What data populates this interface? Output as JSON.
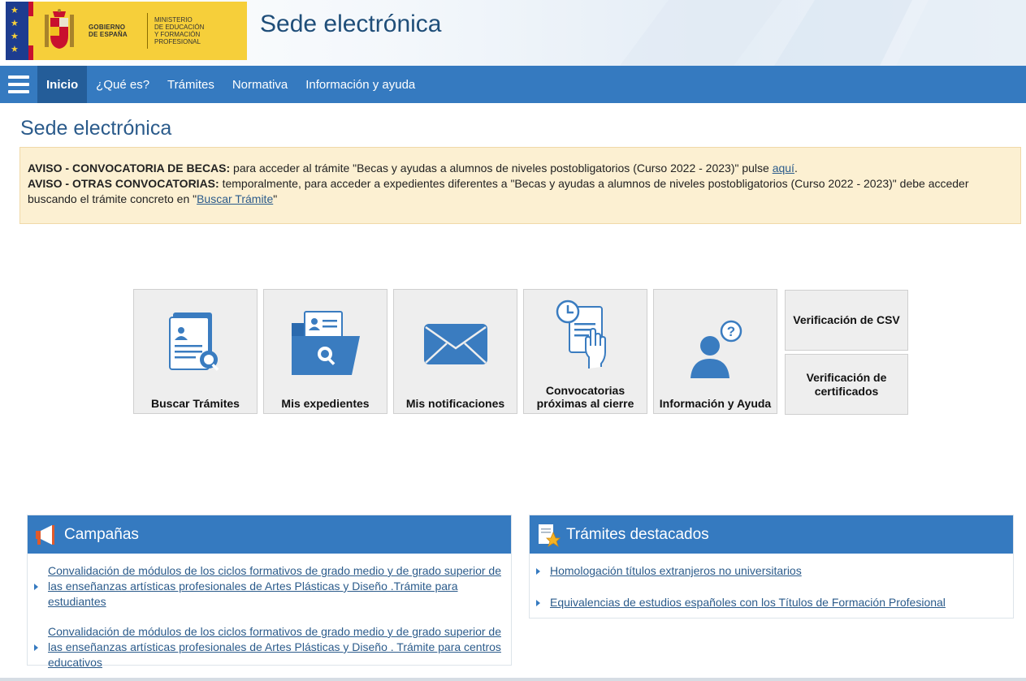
{
  "header": {
    "logo_line1": "GOBIERNO",
    "logo_line2": "DE ESPAÑA",
    "ministry_line1": "MINISTERIO",
    "ministry_line2": "DE EDUCACIÓN",
    "ministry_line3": "Y FORMACIÓN PROFESIONAL",
    "site_title": "Sede electrónica"
  },
  "nav": {
    "items": [
      {
        "label": "Inicio"
      },
      {
        "label": "¿Qué es?"
      },
      {
        "label": "Trámites"
      },
      {
        "label": "Normativa"
      },
      {
        "label": "Información y ayuda"
      }
    ]
  },
  "page_title": "Sede electrónica",
  "notice": {
    "line1_bold": "AVISO - CONVOCATORIA DE BECAS:",
    "line1_text": " para acceder al trámite \"Becas y ayudas a alumnos de niveles postobligatorios (Curso 2022 - 2023)\" pulse ",
    "line1_link": "aquí",
    "line1_end": ".",
    "line2_bold": "AVISO - OTRAS CONVOCATORIAS:",
    "line2_text": " temporalmente, para acceder a expedientes diferentes a \"Becas y ayudas a alumnos de niveles postobligatorios (Curso 2022 - 2023)\" debe acceder buscando el trámite concreto en \"",
    "line2_link": "Buscar Trámite",
    "line2_end": "\""
  },
  "tiles": [
    {
      "label": "Buscar Trámites",
      "icon": "search-document-icon"
    },
    {
      "label": "Mis expedientes",
      "icon": "folder-search-icon"
    },
    {
      "label": "Mis notificaciones",
      "icon": "envelope-icon"
    },
    {
      "label": "Convocatorias próximas al cierre",
      "icon": "clock-document-icon"
    },
    {
      "label": "Información y Ayuda",
      "icon": "user-question-icon"
    }
  ],
  "small_tiles": [
    {
      "label": "Verificación de CSV"
    },
    {
      "label": "Verificación de certificados"
    }
  ],
  "campaigns": {
    "title": "Campañas",
    "items": [
      {
        "text": "Convalidación de módulos de los ciclos formativos de grado medio y de grado superior de las enseñanzas artísticas profesionales de Artes Plásticas y Diseño .Trámite para estudiantes"
      },
      {
        "text": "Convalidación de módulos de los ciclos formativos de grado medio y de grado superior de las enseñanzas artísticas profesionales de Artes Plásticas y Diseño . Trámite para centros educativos"
      }
    ]
  },
  "featured": {
    "title": "Trámites destacados",
    "items": [
      {
        "text": "Homologación títulos extranjeros no universitarios"
      },
      {
        "text": "Equivalencias de estudios españoles con los Títulos de Formación Profesional"
      }
    ]
  },
  "colors": {
    "nav_blue": "#357ac0",
    "nav_active": "#245d99",
    "title_blue": "#2b5b8b",
    "notice_bg": "#fcf0d2",
    "logo_yellow": "#f6cf3a"
  }
}
